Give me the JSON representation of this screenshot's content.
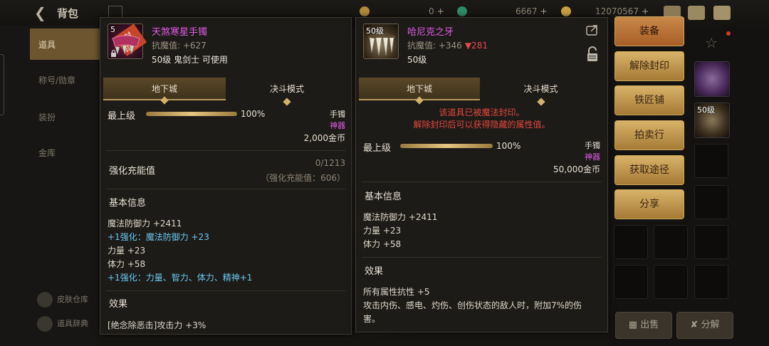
{
  "header": {
    "title": "背包",
    "currency1": "0",
    "currency2": "6667",
    "currency3": "12070567"
  },
  "sidebar": {
    "items": [
      "道具",
      "称号/勋章",
      "装扮",
      "金库"
    ],
    "bottom": [
      "皮肤仓库",
      "道具辞典"
    ]
  },
  "left_item": {
    "name": "天煞寒星手镯",
    "resist": "抗魔值: +627",
    "level_line": "50级 鬼剑士 可使用",
    "icon_level": "5",
    "sealed_tag": "已封印",
    "tabs": [
      "地下城",
      "决斗模式"
    ],
    "max_level_label": "最上级",
    "max_level_percent": "100%",
    "max_level_fraction": 1.0,
    "slot": "手镯",
    "rarity": "神器",
    "price": "2,000金币",
    "charge_title": "强化充能值",
    "charge_value": "0/1213",
    "charge_note": "（强化充能值：606）",
    "basic_title": "基本信息",
    "stats": [
      {
        "text": "魔法防御力 +2411",
        "blue": false
      },
      {
        "text": "+1强化：魔法防御力 +23",
        "blue": true
      },
      {
        "text": "力量 +23",
        "blue": false
      },
      {
        "text": "体力 +58",
        "blue": false
      },
      {
        "text": "+1强化：力量、智力、体力、精神+1",
        "blue": true
      }
    ],
    "effect_title": "效果",
    "effect_text": "[绝念除恶击]攻击力 +3%"
  },
  "right_item": {
    "name": "哈尼克之牙",
    "resist": "抗魔值: +346",
    "resist_diff": "▼281",
    "level_line": "50级",
    "icon_level": "50级",
    "tabs": [
      "地下城",
      "决斗模式"
    ],
    "seal_msg_1": "该道具已被魔法封印。",
    "seal_msg_2": "解除封印后可以获得隐藏的属性值。",
    "max_level_label": "最上级",
    "max_level_percent": "100%",
    "max_level_fraction": 1.0,
    "slot": "手镯",
    "rarity": "神器",
    "price": "50,000金币",
    "basic_title": "基本信息",
    "stats": [
      {
        "text": "魔法防御力 +2411",
        "blue": false
      },
      {
        "text": "力量 +23",
        "blue": false
      },
      {
        "text": "体力 +58",
        "blue": false
      }
    ],
    "effect_title": "效果",
    "effect_line_1": "所有属性抗性 +5",
    "effect_line_2": "攻击内伤、感电、灼伤、创伤状态的敌人时，附加7%的伤",
    "effect_line_3": "害。"
  },
  "actions": [
    "装备",
    "解除封印",
    "铁匠铺",
    "拍卖行",
    "获取途径",
    "分享"
  ],
  "bottom_buttons": [
    "出售",
    "分解"
  ],
  "colors": {
    "epic_purple": "#e15ce5",
    "enhance_blue": "#6cc8f0",
    "warning_red": "#e3473d",
    "button_gold": "#d9b36a"
  }
}
